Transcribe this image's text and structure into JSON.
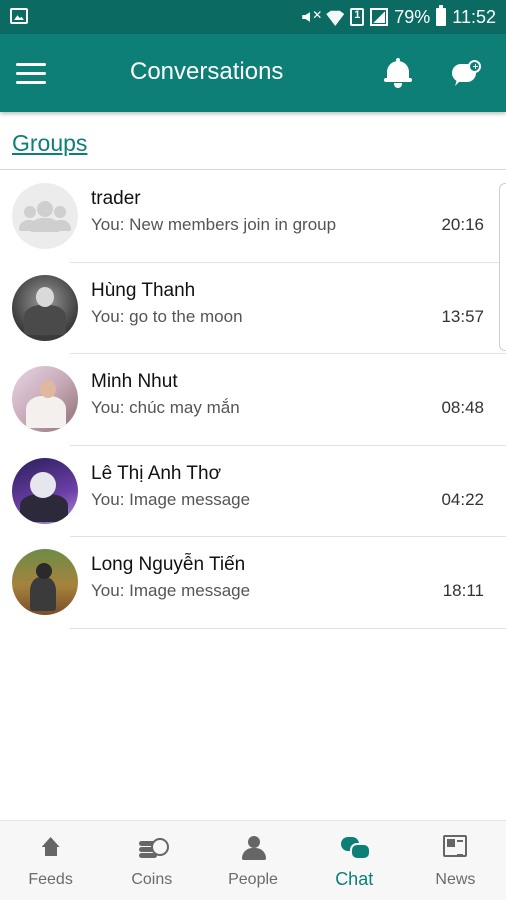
{
  "status_bar": {
    "battery": "79%",
    "time": "11:52"
  },
  "app_bar": {
    "title": "Conversations"
  },
  "groups_link": "Groups",
  "conversations": [
    {
      "name": "trader",
      "message": "You: New members join in group",
      "time": "20:16",
      "avatar": "group-avatar-icon"
    },
    {
      "name": "Hùng Thanh",
      "message": "You: go to the moon",
      "time": "13:57",
      "avatar": "photo"
    },
    {
      "name": "Minh Nhut",
      "message": "You: chúc may mắn",
      "time": "08:48",
      "avatar": "photo"
    },
    {
      "name": "Lê Thị Anh Thơ",
      "message": "You: Image message",
      "time": "04:22",
      "avatar": "photo"
    },
    {
      "name": "Long Nguyễn Tiến",
      "message": "You: Image message",
      "time": "18:11",
      "avatar": "photo"
    }
  ],
  "bottom_nav": [
    {
      "label": "Feeds",
      "icon": "home-icon"
    },
    {
      "label": "Coins",
      "icon": "coins-icon"
    },
    {
      "label": "People",
      "icon": "people-icon"
    },
    {
      "label": "Chat",
      "icon": "chat-icon",
      "active": true
    },
    {
      "label": "News",
      "icon": "news-icon"
    }
  ],
  "colors": {
    "primary": "#0d7f77",
    "status_bar": "#0b6b63",
    "active_tab": "#0d7f77"
  }
}
